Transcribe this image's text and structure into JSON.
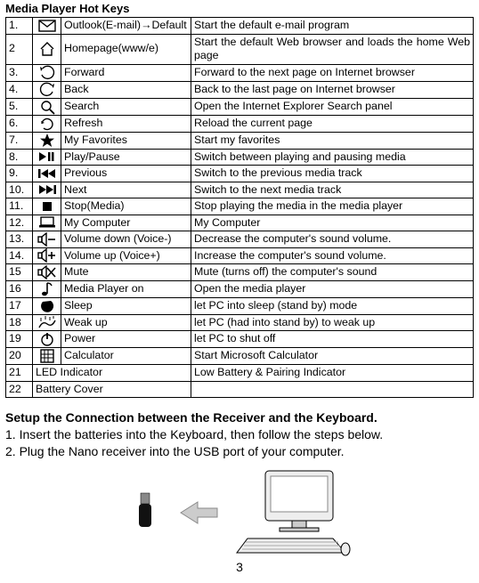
{
  "title": "Media Player Hot Keys",
  "rows": [
    {
      "no": "1.",
      "key": "Outlook(E-mail)→Default",
      "desc": "Start the default e-mail program"
    },
    {
      "no": "2",
      "key": "Homepage(www/e)",
      "desc": "Start the default Web browser and loads the home Web page"
    },
    {
      "no": "3.",
      "key": "Forward",
      "desc": "Forward to the next page on Internet browser"
    },
    {
      "no": "4.",
      "key": "Back",
      "desc": "Back to the last page on Internet browser"
    },
    {
      "no": "5.",
      "key": "Search",
      "desc": "Open the Internet Explorer Search panel"
    },
    {
      "no": "6.",
      "key": "Refresh",
      "desc": "Reload the current page"
    },
    {
      "no": "7.",
      "key": "My Favorites",
      "desc": "Start my favorites"
    },
    {
      "no": "8.",
      "key": "Play/Pause",
      "desc": "Switch between playing and pausing media"
    },
    {
      "no": "9.",
      "key": "Previous",
      "desc": "Switch to the previous media track"
    },
    {
      "no": "10.",
      "key": "Next",
      "desc": "Switch to the next media track"
    },
    {
      "no": "11.",
      "key": "Stop(Media)",
      "desc": "Stop playing the media in the media player"
    },
    {
      "no": "12.",
      "key": "My Computer",
      "desc": "My Computer"
    },
    {
      "no": "13.",
      "key": "Volume down (Voice-)",
      "desc": "Decrease the computer's sound volume."
    },
    {
      "no": "14.",
      "key": "Volume up (Voice+)",
      "desc": "Increase the computer's sound volume."
    },
    {
      "no": "15",
      "key": "Mute",
      "desc": "Mute (turns off) the computer's sound"
    },
    {
      "no": "16",
      "key": "Media Player on",
      "desc": "Open the media player"
    },
    {
      "no": "17",
      "key": "Sleep",
      "desc": "let PC into sleep (stand by) mode"
    },
    {
      "no": "18",
      "key": "Weak up",
      "desc": "let PC (had into stand by) to weak up"
    },
    {
      "no": "19",
      "key": "Power",
      "desc": "let PC to shut off"
    },
    {
      "no": "20",
      "key": "Calculator",
      "desc": "Start Microsoft Calculator"
    }
  ],
  "row21": {
    "no": "21",
    "key": "LED Indicator",
    "desc": "Low Battery & Pairing Indicator"
  },
  "row22": {
    "no": "22",
    "key": "Battery Cover",
    "desc": ""
  },
  "setupTitle": "Setup the Connection between the Receiver and the Keyboard.",
  "step1": "1. Insert the batteries into the Keyboard, then follow the steps below.",
  "step2": "2. Plug the Nano receiver into the USB port of your computer.",
  "pageNumber": "3"
}
